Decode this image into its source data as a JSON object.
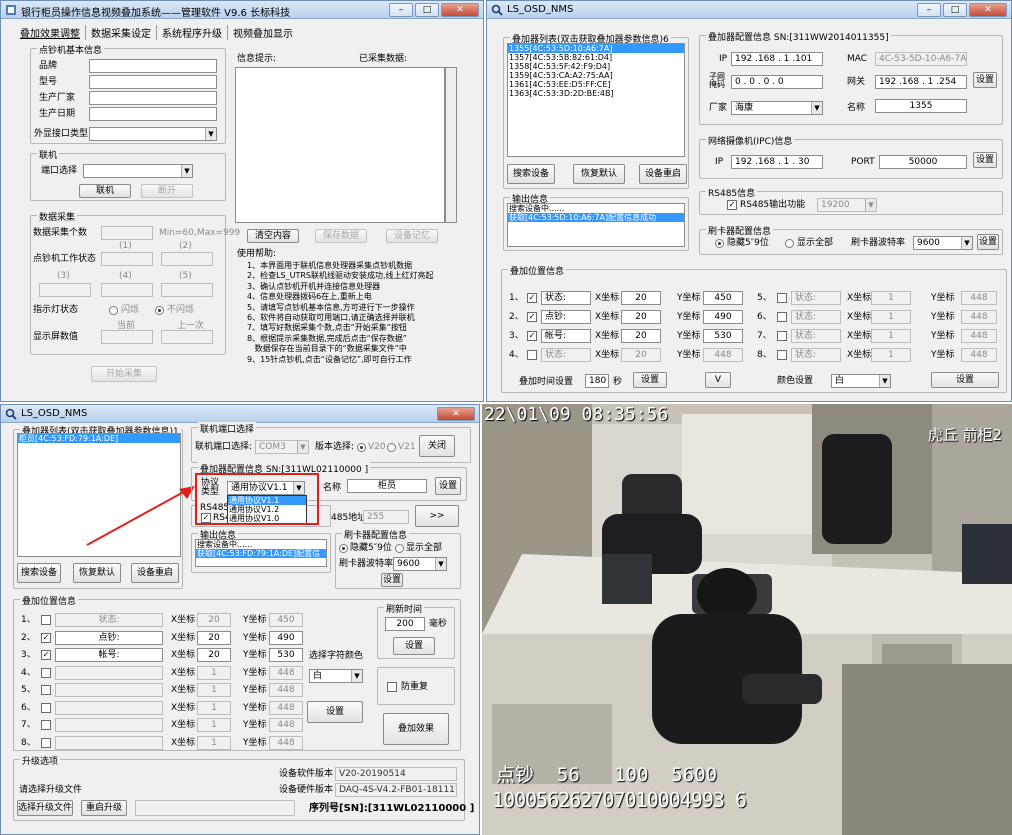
{
  "win1": {
    "title": "银行柜员操作信息视频叠加系统——管理软件 V9.6    长标科技",
    "tabs": [
      "叠加效果调整",
      "数据采集设定",
      "系统程序升级",
      "视频叠加显示"
    ],
    "info_group": "点钞机基本信息",
    "info_labels": [
      "品牌",
      "型号",
      "生产厂家",
      "生产日期"
    ],
    "port_type_label": "外显接口类型",
    "conn_group": "联机",
    "port_select_label": "端口选择",
    "connect_btn": "联机",
    "disconnect_btn": "断开",
    "collect_group": "数据采集",
    "collect_count_label": "数据采集个数",
    "range_hint": "Min=60,Max=999",
    "status_label": "点钞机工作状态",
    "col1": "(1)",
    "col2": "(2)",
    "col3": "(3)",
    "col4": "(4)",
    "col5": "(5)",
    "indicator_label": "指示灯状态",
    "blink": "闪烁",
    "no_blink": "不闪烁",
    "display_label": "显示屏数值",
    "current": "当前",
    "previous": "上一次",
    "start_btn": "开始采集",
    "msg_label": "信息提示:",
    "collected_label": "已采集数据:",
    "clear_btn": "清空内容",
    "save_btn": "保存数据",
    "memory_btn": "设备记忆",
    "help_title": "使用帮助:",
    "help": [
      "1、本界面用于联机信息处理器采集点钞机数据",
      "2、检查LS_UTRS联机线驱动安装成功,线上红灯亮起",
      "3、确认点钞机开机并连接信息处理器",
      "4、信息处理器拨码6在上,重新上电",
      "5、请填写点钞机基本信息,方可进行下一步操作",
      "6、软件将自动获取可用端口,请正确选择并联机",
      "7、填写好数据采集个数,点击“开始采集”按钮",
      "8、根据提示采集数据,完成后点击“保存数据”",
      "   数据保存在当前目录下的“数据采集文件”中",
      "9、15针点钞机,点击“设备记忆”,即可自行工作"
    ]
  },
  "win2": {
    "title": "LS_OSD_NMS",
    "list_group": "叠加器列表(双击获取叠加器参数信息)6",
    "list": [
      "1355[4C:53:5D:10:A6:7A]",
      "1357[4C:53:5B:82:61:D4]",
      "1358[4C:53:5F:42:F9:D4]",
      "1359[4C:53:CA:A2:75:AA]",
      "1361[4C:53:EE:D5:FF:CE]",
      "1363[4C:53:3D:2D:BE:4B]"
    ],
    "search_btn": "搜索设备",
    "restore_btn": "恢复默认",
    "reboot_btn": "设备重启",
    "out_group": "输出信息",
    "out": [
      "搜索设备中......",
      "获取[4C:53:5D:10:A6:7A]配置信息成功"
    ],
    "cfg_group": "叠加器配置信息 SN:[311WW2014011355]",
    "ip_label": "IP",
    "ip": "192 .168 . 1  .101",
    "mac_label": "MAC",
    "mac": "4C-53-5D-10-A6-7A",
    "mask_label": "子网掩码",
    "mask": "0  . 0  . 0  . 0",
    "gw_label": "网关",
    "gw": "192 .168 . 1  .254",
    "set": "设置",
    "vendor_label": "厂家",
    "vendor": "海康",
    "name_label": "名称",
    "name": "1355",
    "ipc_group": "网络摄像机(IPC)信息",
    "ipc_ip_label": "IP",
    "ipc_ip": "192 .168 . 1  . 30",
    "port_label": "PORT",
    "port": "50000",
    "rs485_group": "RS485信息",
    "rs485_chk": "RS485输出功能",
    "rs485_val": "19200",
    "card_group": "刷卡器配置信息",
    "hide": "隐藏5″9位",
    "show_all": "显示全部",
    "baud_label": "刷卡器波特率",
    "baud": "9600",
    "pos_group": "叠加位置信息",
    "rows_left": [
      {
        "n": "1、",
        "on": true,
        "label": "状态:",
        "x": "20",
        "y": "450"
      },
      {
        "n": "2、",
        "on": true,
        "label": "点钞:",
        "x": "20",
        "y": "490"
      },
      {
        "n": "3、",
        "on": true,
        "label": "帐号:",
        "x": "20",
        "y": "530"
      },
      {
        "n": "4、",
        "on": false,
        "label": "状态:",
        "x": "20",
        "y": "448"
      }
    ],
    "rows_right": [
      {
        "n": "5、",
        "label": "状态:",
        "x": "1",
        "y": "448"
      },
      {
        "n": "6、",
        "label": "状态:",
        "x": "1",
        "y": "448"
      },
      {
        "n": "7、",
        "label": "状态:",
        "x": "1",
        "y": "448"
      },
      {
        "n": "8、",
        "label": "状态:",
        "x": "1",
        "y": "448"
      }
    ],
    "x_label": "X坐标",
    "y_label": "Y坐标",
    "time_label": "叠加时间设置",
    "time": "180",
    "sec": "秒",
    "v_btn": "V",
    "color_label": "颜色设置",
    "color": "白"
  },
  "win3": {
    "title": "LS_OSD_NMS",
    "list_group": "叠加器列表(双击获取叠加器参数信息)1",
    "list": [
      "柜员[4C:53:FD:79:1A:DE]"
    ],
    "search_btn": "搜索设备",
    "restore_btn": "恢复默认",
    "reboot_btn": "设备重启",
    "conn_group": "联机端口选择",
    "conn_label": "联机端口选择:",
    "conn": "COM3",
    "ver_label": "版本选择:",
    "v20": "V20",
    "v21": "V21",
    "close_btn": "关闭",
    "cfg_group": "叠加器配置信息 SN:[311WL02110000  ]",
    "proto_label": "协议类型",
    "proto": "通用协议V1.1",
    "proto_opts": [
      "通用协议V1.1",
      "通用协议V1.2",
      "通用协议V1.0"
    ],
    "name_label": "名称",
    "name": "柜员",
    "set": "设置",
    "rs485_group": "RS485信",
    "rs485_chk": "RS4",
    "addr_label": "485地址",
    "addr": "255",
    "arrow_btn": ">>",
    "out_group": "输出信息",
    "out": [
      "搜索设备中......",
      "获取[4C:53:FD:79:1A:DE]配置信"
    ],
    "card_group": "刷卡器配置信息",
    "hide": "隐藏5″9位",
    "show_all": "显示全部",
    "baud_label": "刷卡器波特率",
    "baud": "9600",
    "pos_group": "叠加位置信息",
    "rows": [
      {
        "n": "1、",
        "on": false,
        "label": "状态:",
        "x": "20",
        "y": "450"
      },
      {
        "n": "2、",
        "on": true,
        "label": "点钞:",
        "x": "20",
        "y": "490"
      },
      {
        "n": "3、",
        "on": true,
        "label": "帐号:",
        "x": "20",
        "y": "530"
      },
      {
        "n": "4、",
        "on": false,
        "label": "",
        "x": "1",
        "y": "448"
      },
      {
        "n": "5、",
        "on": false,
        "label": "",
        "x": "1",
        "y": "448"
      },
      {
        "n": "6、",
        "on": false,
        "label": "",
        "x": "1",
        "y": "448"
      },
      {
        "n": "7、",
        "on": false,
        "label": "",
        "x": "1",
        "y": "448"
      },
      {
        "n": "8、",
        "on": false,
        "label": "",
        "x": "1",
        "y": "448"
      }
    ],
    "x_label": "X坐标",
    "y_label": "Y坐标",
    "color_label": "选择字符颜色",
    "color": "白",
    "refresh_group": "刷新时间",
    "refresh": "200",
    "ms": "毫秒",
    "anti_dup": "防重复",
    "effect_btn": "叠加效果",
    "upgrade_group": "升级选项",
    "choose_file_label": "请选择升级文件",
    "choose_btn": "选择升级文件",
    "restart_btn": "重启升级",
    "sw_label": "设备软件版本",
    "sw": "V20-20190514",
    "hw_label": "设备硬件版本",
    "hw": "DAQ-4S-V4.2-FB01-181117",
    "serial": "序列号[SN]:[311WL02110000  ]"
  },
  "video": {
    "timestamp": "22\\01\\09 08:35:56",
    "camera": "虎丘 前柜2",
    "overlay1": "点钞  56   100  5600",
    "overlay2": "100056262707010004993 6"
  }
}
